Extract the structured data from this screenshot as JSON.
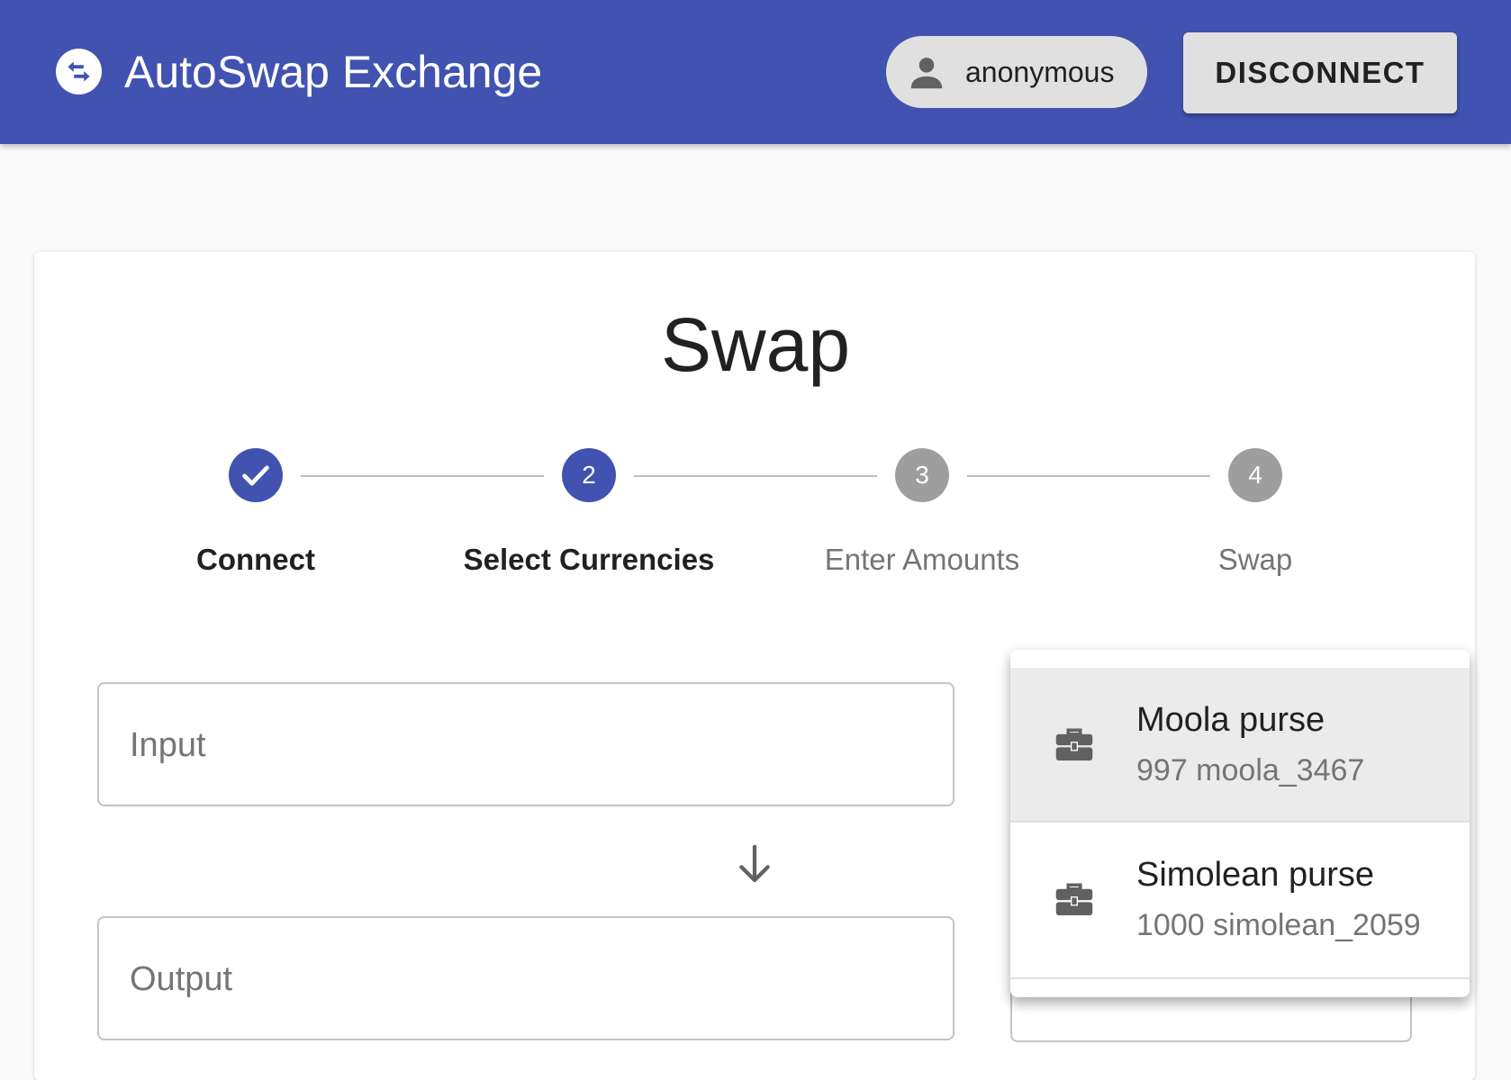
{
  "app": {
    "title": "AutoSwap Exchange",
    "icon": "swap-horizontal-circle-icon",
    "user_name": "anonymous",
    "user_icon": "person-icon",
    "disconnect_label": "DISCONNECT"
  },
  "colors": {
    "primary": "#4152b0",
    "inactive_step": "#9e9e9e",
    "chip_bg": "#e0e0e0",
    "selected_item_bg": "#ebebeb"
  },
  "card": {
    "title": "Swap"
  },
  "stepper": {
    "steps": [
      {
        "label": "Connect",
        "state": "completed",
        "icon": "check-icon"
      },
      {
        "label": "Select Currencies",
        "number": "2",
        "state": "active"
      },
      {
        "label": "Enter Amounts",
        "number": "3",
        "state": "inactive"
      },
      {
        "label": "Swap",
        "number": "4",
        "state": "inactive"
      }
    ]
  },
  "form": {
    "input_label": "Input",
    "output_label": "Output",
    "arrow_icon": "arrow-down-icon"
  },
  "purse_menu": {
    "items": [
      {
        "name": "Moola purse",
        "balance": "997 moola_3467",
        "icon": "briefcase-icon",
        "selected": true
      },
      {
        "name": "Simolean purse",
        "balance": "1000 simolean_2059",
        "icon": "briefcase-icon",
        "selected": false
      }
    ]
  }
}
